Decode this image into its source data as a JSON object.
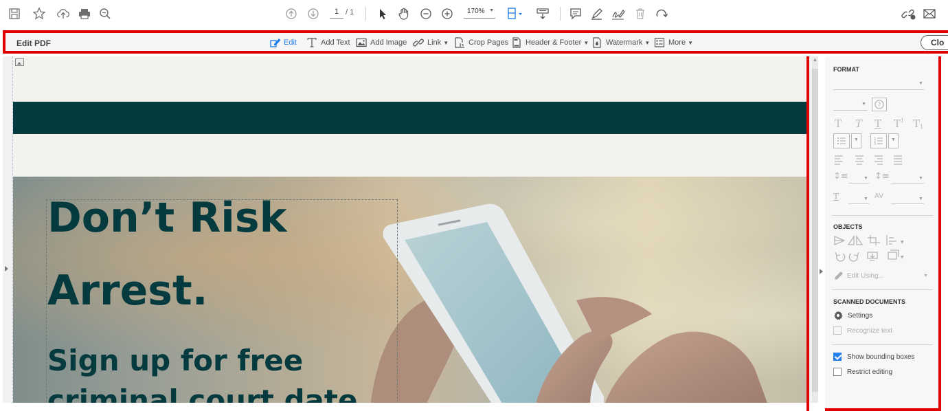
{
  "top_toolbar": {
    "page_current": "1",
    "page_total": "/ 1",
    "zoom": "170%"
  },
  "edit_bar": {
    "title": "Edit PDF",
    "items": [
      {
        "label": "Edit",
        "icon": "edit-icon"
      },
      {
        "label": "Add Text",
        "icon": "add-text-icon"
      },
      {
        "label": "Add Image",
        "icon": "add-image-icon"
      },
      {
        "label": "Link",
        "icon": "link-icon"
      },
      {
        "label": "Crop Pages",
        "icon": "crop-pages-icon"
      },
      {
        "label": "Header & Footer",
        "icon": "header-footer-icon"
      },
      {
        "label": "Watermark",
        "icon": "watermark-icon"
      },
      {
        "label": "More",
        "icon": "more-icon"
      }
    ],
    "close_label": "Clo"
  },
  "document": {
    "headline_line1": "Don’t Risk",
    "headline_line2": "Arrest.",
    "subhead_line1": "Sign up for free",
    "subhead_line2": "criminal court date"
  },
  "right_panel": {
    "format_title": "FORMAT",
    "objects_title": "OBJECTS",
    "edit_using": "Edit Using...",
    "scanned_title": "SCANNED DOCUMENTS",
    "settings_label": "Settings",
    "recognize_label": "Recognize text",
    "show_bbox_label": "Show bounding boxes",
    "show_bbox_checked": true,
    "restrict_label": "Restrict editing",
    "restrict_checked": false
  },
  "colors": {
    "highlight": "#e00000",
    "brand_teal": "#053a3f",
    "accent_blue": "#2680eb"
  }
}
